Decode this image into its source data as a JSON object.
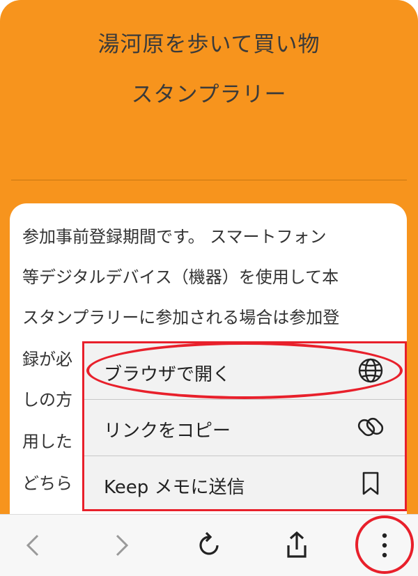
{
  "header": {
    "title_line1": "湯河原を歩いて買い物",
    "title_line2": "スタンプラリー",
    "color": "#F7941D"
  },
  "content": {
    "lines": [
      "参加事前登録期間です。 スマートフォン",
      "等デジタルデバイス（機器）を使用して本",
      "スタンプラリーに参加される場合は参加登",
      "録が必",
      "しの方",
      "用した",
      "どちら"
    ]
  },
  "context_menu": {
    "items": [
      {
        "label": "ブラウザで開く",
        "icon": "globe-icon"
      },
      {
        "label": "リンクをコピー",
        "icon": "link-icon"
      },
      {
        "label": "Keep メモに送信",
        "icon": "bookmark-icon"
      }
    ],
    "highlight_color": "#e8202b"
  },
  "toolbar": {
    "buttons": [
      {
        "name": "back",
        "icon": "chevron-left-icon"
      },
      {
        "name": "forward",
        "icon": "chevron-right-icon"
      },
      {
        "name": "reload",
        "icon": "reload-icon"
      },
      {
        "name": "share",
        "icon": "share-icon"
      },
      {
        "name": "more",
        "icon": "more-vertical-icon"
      }
    ]
  }
}
